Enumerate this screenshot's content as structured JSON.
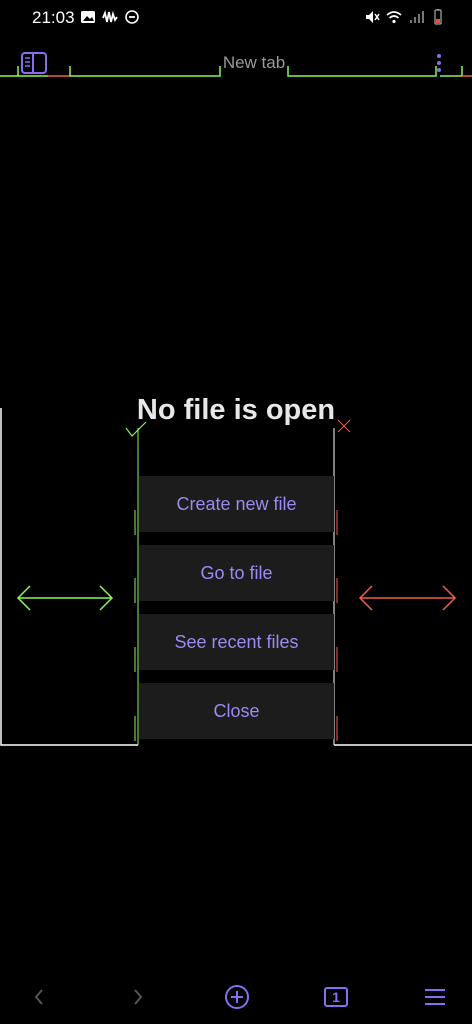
{
  "status_bar": {
    "time": "21:03",
    "left_icons": [
      "image-icon",
      "waveform-icon",
      "do-not-disturb-icon"
    ],
    "right_icons": [
      "mute-icon",
      "wifi-icon",
      "signal-icon",
      "battery-icon"
    ]
  },
  "tab_bar": {
    "title": "New tab",
    "left_icon": "sidebar-toggle-icon",
    "right_icon": "more-options-icon"
  },
  "empty_state": {
    "title": "No file is open",
    "actions": [
      {
        "label": "Create new file"
      },
      {
        "label": "Go to file"
      },
      {
        "label": "See recent files"
      },
      {
        "label": "Close"
      }
    ]
  },
  "bottom_nav": {
    "back_icon": "chevron-left-icon",
    "forward_icon": "chevron-right-icon",
    "new_tab_icon": "plus-circle-icon",
    "tab_count": "1",
    "menu_icon": "hamburger-menu-icon"
  },
  "colors": {
    "accent": "#8a6cf0",
    "button_text": "#9c8af3",
    "button_bg": "#1c1c1c",
    "guide_green": "#8cf55a",
    "guide_red": "#f0604a",
    "guide_white": "#ffffff"
  }
}
